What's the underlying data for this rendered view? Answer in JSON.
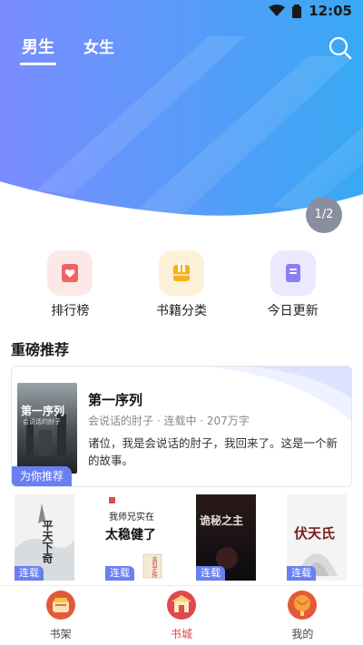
{
  "status": {
    "time": "12:05"
  },
  "header": {
    "tabs": [
      {
        "label": "男生",
        "active": true
      },
      {
        "label": "女生",
        "active": false
      }
    ]
  },
  "banner": {
    "pager": "1/2",
    "gradient": [
      "#7a8cff",
      "#35a8f2"
    ]
  },
  "entries": [
    {
      "label": "排行榜",
      "icon": "ranking-icon",
      "bg": "#fde8e8",
      "color": "#f06363"
    },
    {
      "label": "书籍分类",
      "icon": "category-icon",
      "bg": "#fdf1d8",
      "color": "#f5b21d"
    },
    {
      "label": "今日更新",
      "icon": "update-icon",
      "bg": "#ece8fd",
      "color": "#8c7ef5"
    }
  ],
  "section": {
    "title": "重磅推荐"
  },
  "featured": {
    "title": "第一序列",
    "meta": "会说话的肘子 · 连载中 · 207万字",
    "desc": "诸位，我是会说话的肘子，我回来了。这是一个新的故事。",
    "badge": "为你推荐",
    "cover_text": "第一序列",
    "cover_subtext": "会说话的肘子"
  },
  "books": [
    {
      "badge": "连载",
      "cover_text": "平天下奇"
    },
    {
      "badge": "连载",
      "cover_top": "我师兄实在",
      "cover_main": "太稳健了",
      "cover_small": "言归正传"
    },
    {
      "badge": "连载",
      "cover_text": "诡秘之主"
    },
    {
      "badge": "连载",
      "cover_text": "伏天氏"
    }
  ],
  "nav": [
    {
      "label": "书架",
      "icon": "bookshelf-icon",
      "active": false
    },
    {
      "label": "书城",
      "icon": "bookstore-icon",
      "active": true
    },
    {
      "label": "我的",
      "icon": "profile-icon",
      "active": false
    }
  ]
}
